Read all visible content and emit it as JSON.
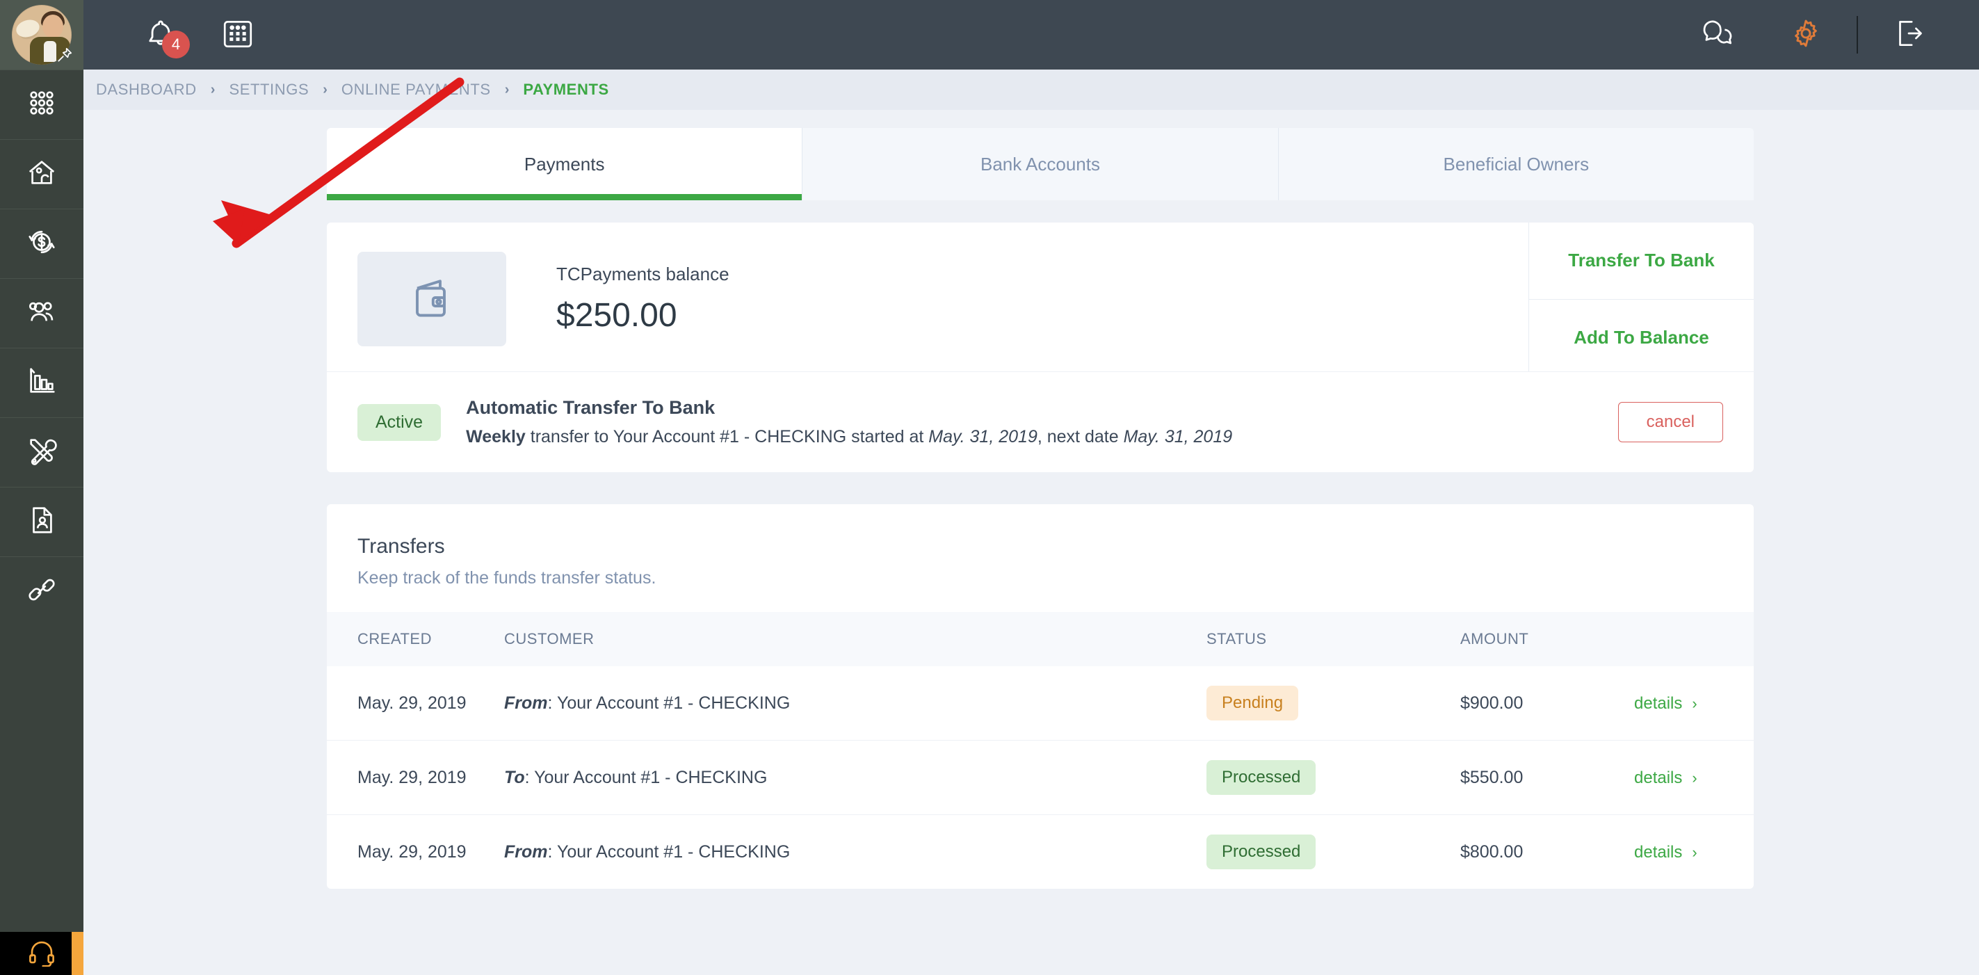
{
  "colors": {
    "rail_bg": "#3a423d",
    "topbar_bg": "#3e4852",
    "breadcrumb_bg": "#e6eaf1",
    "page_bg": "#eef1f6",
    "accent_green": "#3ca844",
    "accent_orange": "#e07b39",
    "danger_red": "#d9534f",
    "pending_bg": "#fdebd5",
    "pending_text": "#c8801f",
    "processed_bg": "#d9f0d6",
    "processed_text": "#2f6d33",
    "annotation_red": "#e01b1b"
  },
  "rail": {
    "avatar_name": "user-avatar",
    "pin_icon": "pushpin-icon",
    "items": [
      {
        "icon": "apps-grid-icon",
        "name": "sidebar-item-apps"
      },
      {
        "icon": "home-icon",
        "name": "sidebar-item-home"
      },
      {
        "icon": "refund-dollar-icon",
        "name": "sidebar-item-payments"
      },
      {
        "icon": "users-icon",
        "name": "sidebar-item-customers"
      },
      {
        "icon": "bar-chart-icon",
        "name": "sidebar-item-reports"
      },
      {
        "icon": "tools-icon",
        "name": "sidebar-item-tools"
      },
      {
        "icon": "document-user-icon",
        "name": "sidebar-item-documents"
      },
      {
        "icon": "link-chain-icon",
        "name": "sidebar-item-links"
      }
    ],
    "support_icon": "headset-icon"
  },
  "topbar": {
    "bell_icon": "bell-icon",
    "bell_badge": "4",
    "calendar_icon": "calendar-icon",
    "chat_icon": "chat-bubbles-icon",
    "settings_icon": "gear-icon",
    "logout_icon": "logout-icon"
  },
  "breadcrumb": {
    "separator": "›",
    "items": [
      {
        "label": "DASHBOARD",
        "active": false
      },
      {
        "label": "SETTINGS",
        "active": false
      },
      {
        "label": "ONLINE PAYMENTS",
        "active": false
      },
      {
        "label": "PAYMENTS",
        "active": true
      }
    ]
  },
  "tabs": [
    {
      "label": "Payments",
      "active": true
    },
    {
      "label": "Bank Accounts",
      "active": false
    },
    {
      "label": "Beneficial Owners",
      "active": false
    }
  ],
  "balance": {
    "icon": "wallet-icon",
    "label": "TCPayments balance",
    "amount": "$250.00",
    "transfer_to_bank_label": "Transfer To Bank",
    "add_to_balance_label": "Add To Balance"
  },
  "auto_transfer": {
    "status": "Active",
    "title": "Automatic Transfer To Bank",
    "frequency": "Weekly",
    "desc_part1": " transfer to Your Account #1 - CHECKING started at ",
    "start_date": "May. 31, 2019",
    "desc_part2": ", next date ",
    "next_date": "May. 31, 2019",
    "cancel_label": "cancel"
  },
  "transfers": {
    "title": "Transfers",
    "subtitle": "Keep track of the funds transfer status.",
    "columns": [
      "CREATED",
      "CUSTOMER",
      "STATUS",
      "AMOUNT"
    ],
    "details_label": "details",
    "details_chevron": "›",
    "rows": [
      {
        "created": "May. 29, 2019",
        "direction": "From",
        "account": ": Your Account #1 - CHECKING",
        "status": "Pending",
        "status_kind": "pending",
        "amount": "$900.00"
      },
      {
        "created": "May. 29, 2019",
        "direction": "To",
        "account": ": Your Account #1 - CHECKING",
        "status": "Processed",
        "status_kind": "processed",
        "amount": "$550.00"
      },
      {
        "created": "May. 29, 2019",
        "direction": "From",
        "account": ": Your Account #1 - CHECKING",
        "status": "Processed",
        "status_kind": "processed",
        "amount": "$800.00"
      }
    ]
  },
  "annotation": {
    "name": "red-arrow-annotation",
    "points_to": "wallet-icon-tile"
  }
}
